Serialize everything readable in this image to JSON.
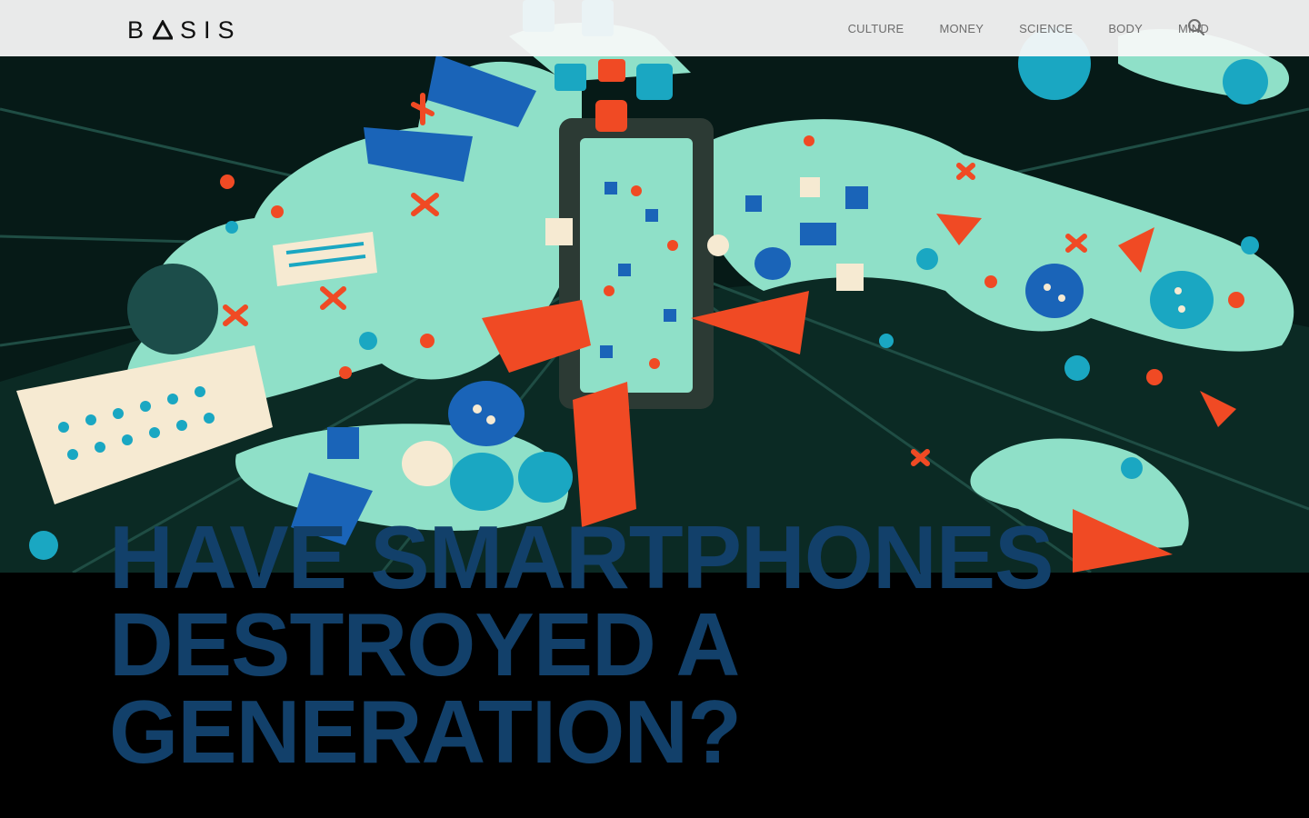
{
  "brand": {
    "name": "BASIS"
  },
  "nav": {
    "items": [
      {
        "label": "CULTURE"
      },
      {
        "label": "MONEY"
      },
      {
        "label": "SCIENCE"
      },
      {
        "label": "BODY"
      },
      {
        "label": "MIND"
      }
    ],
    "search_icon": "search-icon"
  },
  "article": {
    "headline": "HAVE SMARTPHONES DESTROYED A GENERATION?"
  },
  "colors": {
    "background": "#000000",
    "headline": "#12406a",
    "mint": "#8fe0c8",
    "red": "#f04a24",
    "blue": "#1a64b8",
    "teal": "#1aa7c2",
    "cream": "#f6ead2"
  }
}
